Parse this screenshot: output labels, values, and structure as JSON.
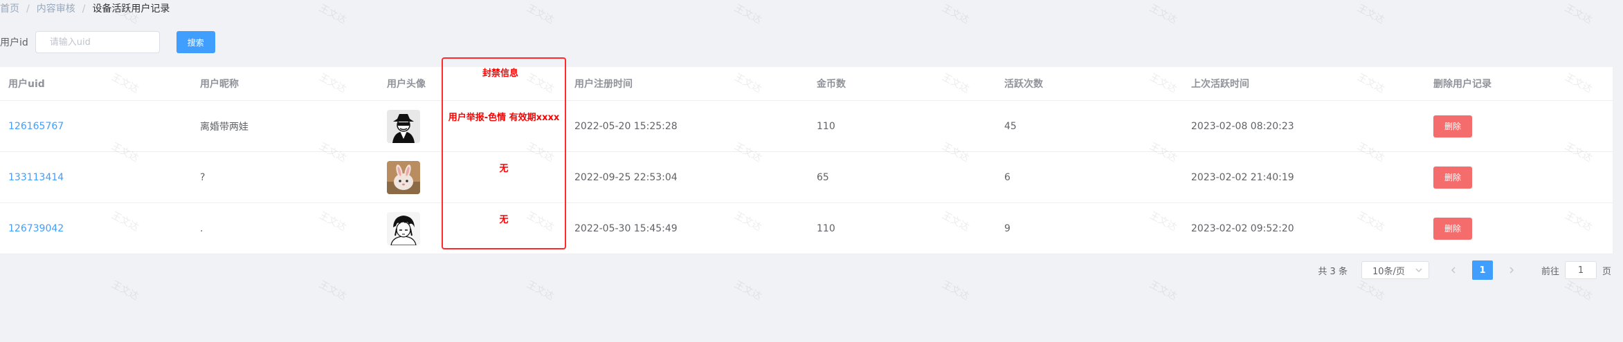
{
  "breadcrumb": [
    "首页",
    "内容审核",
    "设备活跃用户记录"
  ],
  "search": {
    "label": "用户id",
    "placeholder": "请输入uid",
    "value": "",
    "button_label": "搜索"
  },
  "table": {
    "columns": [
      "用户uid",
      "用户昵称",
      "用户头像",
      "封禁信息",
      "用户注册时间",
      "金币数",
      "活跃次数",
      "上次活跃时间",
      "删除用户记录"
    ],
    "rows": [
      {
        "uid": "126165767",
        "nickname": "离婚带两娃",
        "avatar": "avatar-spy",
        "ban": "用户举报-色情 有效期xxxx",
        "registered": "2022-05-20 15:25:28",
        "coins": "110",
        "active_count": "45",
        "last_active": "2023-02-08 08:20:23",
        "delete_label": "删除"
      },
      {
        "uid": "133113414",
        "nickname": "?",
        "avatar": "avatar-bunny",
        "ban": "无",
        "registered": "2022-09-25 22:53:04",
        "coins": "65",
        "active_count": "6",
        "last_active": "2023-02-02 21:40:19",
        "delete_label": "删除"
      },
      {
        "uid": "126739042",
        "nickname": ".",
        "avatar": "avatar-anime",
        "ban": "无",
        "registered": "2022-05-30 15:45:49",
        "coins": "110",
        "active_count": "9",
        "last_active": "2023-02-02 09:52:20",
        "delete_label": "删除"
      }
    ]
  },
  "pagination": {
    "total_text": "共 3 条",
    "page_size": "10条/页",
    "current_page": "1",
    "goto_label": "前往",
    "goto_value": "1",
    "page_suffix": "页"
  },
  "watermark": "王文达",
  "colors": {
    "primary": "#409eff",
    "danger": "#f56c6c",
    "annotation": "#ff2a2a"
  }
}
